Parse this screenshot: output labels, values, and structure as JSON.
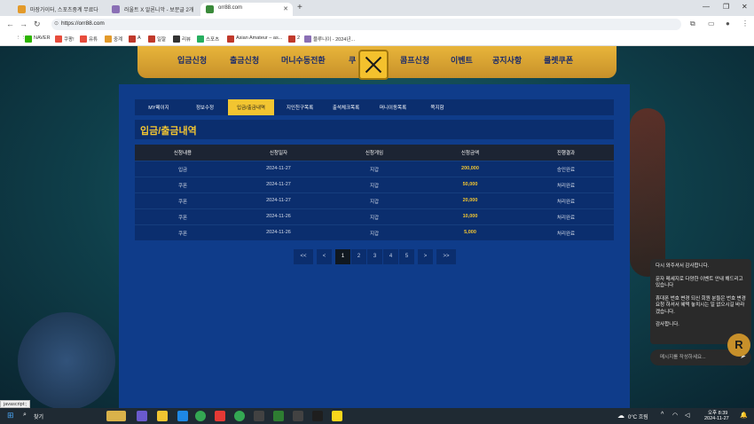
{
  "browser": {
    "tabs": [
      {
        "title": "마장가이터, 스포츠중계 무료다"
      },
      {
        "title": "러울트 X 알론니악 - 보문글 2개"
      },
      {
        "title": "orr88.com"
      }
    ],
    "url": "https://orr88.com",
    "bookmarks": [
      "NAVER",
      "쿠팡!",
      "유튜",
      "중계",
      "A",
      "일잘",
      "리뷰",
      "스포츠",
      "Asian Amateur – as...",
      "2",
      "블루니이 - 2024년..."
    ]
  },
  "site": {
    "topnav": [
      "입금신청",
      "출금신청",
      "머니수동전환",
      "쿠",
      "콤프신청",
      "이벤트",
      "공지사항",
      "룰렛쿠폰"
    ],
    "subtabs": [
      "MY페이지",
      "정보수정",
      "입금/출금내역",
      "지인친구목록",
      "출석체크목록",
      "머니이동목록",
      "쪽지함"
    ],
    "active_subtab_index": 2,
    "section_title": "입금/출금내역",
    "table": {
      "headers": [
        "신청내용",
        "신청일자",
        "신청게임",
        "신청금액",
        "진행결과"
      ],
      "rows": [
        [
          "입금",
          "2024-11-27",
          "지갑",
          "200,000",
          "승인완료"
        ],
        [
          "쿠폰",
          "2024-11-27",
          "지갑",
          "50,000",
          "처리완료"
        ],
        [
          "쿠폰",
          "2024-11-27",
          "지갑",
          "20,000",
          "처리완료"
        ],
        [
          "쿠폰",
          "2024-11-26",
          "지갑",
          "10,000",
          "처리완료"
        ],
        [
          "쿠폰",
          "2024-11-26",
          "지갑",
          "5,000",
          "처리완료"
        ]
      ]
    },
    "pager": {
      "first": "<<",
      "prev": "<",
      "pages": [
        "1",
        "2",
        "3",
        "4",
        "5"
      ],
      "active": "1",
      "next": ">",
      "last": ">>"
    }
  },
  "chat": {
    "lines": [
      "다시 와주셔서 감사합니다.",
      "문자 메세지로 다양한 이벤트 안내 해드리고 있습니다",
      "휴대폰 번호 변경 되신 회원 분들은 번호 변경 요청 하셔서 혜택 놓치시는 일 없으시길 바라겠습니다.",
      "감사합니다."
    ],
    "placeholder": "메시지를 작성하세요..."
  },
  "status_text": "javascript:;",
  "taskbar": {
    "search": "찾기",
    "weather": "0°C 흐림",
    "time": "오후 8:39",
    "date": "2024-11-27"
  }
}
